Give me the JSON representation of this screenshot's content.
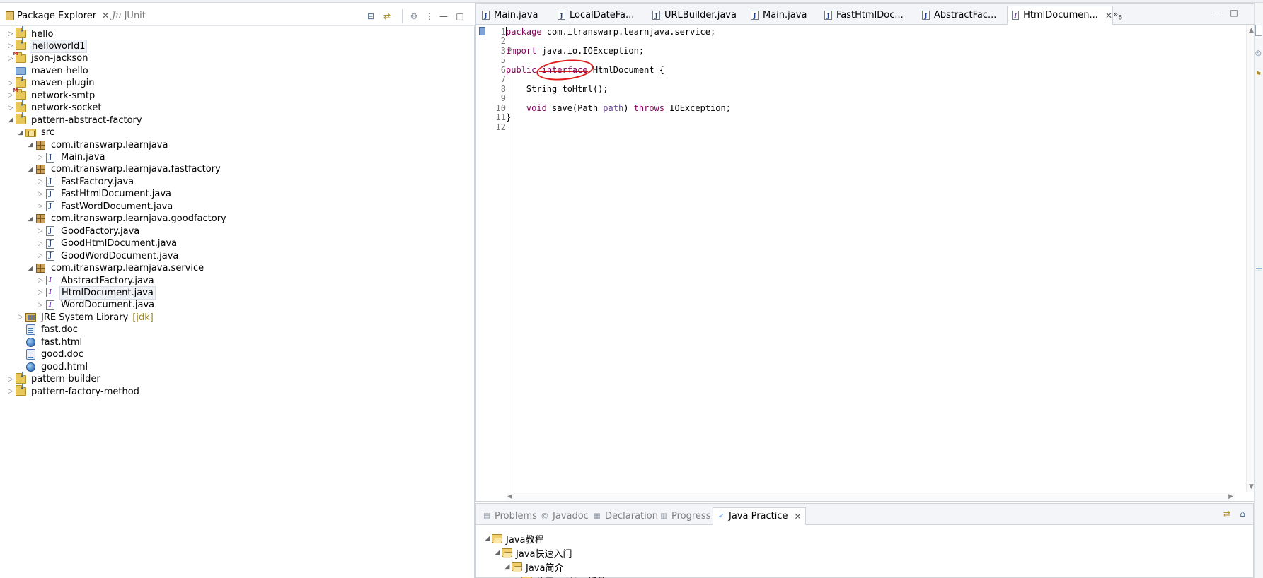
{
  "package_explorer": {
    "tabs": [
      {
        "label": "Package Explorer",
        "active": true
      },
      {
        "label": "JUnit",
        "prefix": "Ju",
        "active": false
      }
    ],
    "tree": [
      {
        "label": "hello",
        "icon": "project-icon",
        "depth": 0,
        "twisty": "collapsed"
      },
      {
        "label": "helloworld1",
        "icon": "project-icon",
        "depth": 0,
        "twisty": "collapsed",
        "selected": true
      },
      {
        "label": "json-jackson",
        "icon": "maven-project-icon",
        "depth": 0,
        "twisty": "collapsed"
      },
      {
        "label": "maven-hello",
        "icon": "folder-icon",
        "depth": 0,
        "twisty": "none"
      },
      {
        "label": "maven-plugin",
        "icon": "project-icon",
        "depth": 0,
        "twisty": "collapsed"
      },
      {
        "label": "network-smtp",
        "icon": "maven-project-icon",
        "depth": 0,
        "twisty": "collapsed"
      },
      {
        "label": "network-socket",
        "icon": "project-icon",
        "depth": 0,
        "twisty": "collapsed"
      },
      {
        "label": "pattern-abstract-factory",
        "icon": "project-icon",
        "depth": 0,
        "twisty": "expanded"
      },
      {
        "label": "src",
        "icon": "source-folder-icon",
        "depth": 1,
        "twisty": "expanded"
      },
      {
        "label": "com.itranswarp.learnjava",
        "icon": "package-icon",
        "depth": 2,
        "twisty": "expanded"
      },
      {
        "label": "Main.java",
        "icon": "java-file-icon",
        "depth": 3,
        "twisty": "collapsed"
      },
      {
        "label": "com.itranswarp.learnjava.fastfactory",
        "icon": "package-icon",
        "depth": 2,
        "twisty": "expanded"
      },
      {
        "label": "FastFactory.java",
        "icon": "java-file-icon",
        "depth": 3,
        "twisty": "collapsed"
      },
      {
        "label": "FastHtmlDocument.java",
        "icon": "java-file-icon",
        "depth": 3,
        "twisty": "collapsed"
      },
      {
        "label": "FastWordDocument.java",
        "icon": "java-file-icon",
        "depth": 3,
        "twisty": "collapsed"
      },
      {
        "label": "com.itranswarp.learnjava.goodfactory",
        "icon": "package-icon",
        "depth": 2,
        "twisty": "expanded"
      },
      {
        "label": "GoodFactory.java",
        "icon": "java-file-icon",
        "depth": 3,
        "twisty": "collapsed"
      },
      {
        "label": "GoodHtmlDocument.java",
        "icon": "java-file-icon",
        "depth": 3,
        "twisty": "collapsed"
      },
      {
        "label": "GoodWordDocument.java",
        "icon": "java-file-icon",
        "depth": 3,
        "twisty": "collapsed"
      },
      {
        "label": "com.itranswarp.learnjava.service",
        "icon": "package-icon",
        "depth": 2,
        "twisty": "expanded"
      },
      {
        "label": "AbstractFactory.java",
        "icon": "java-interface-file-icon",
        "depth": 3,
        "twisty": "collapsed"
      },
      {
        "label": "HtmlDocument.java",
        "icon": "java-interface-file-icon",
        "depth": 3,
        "twisty": "collapsed",
        "selected": true
      },
      {
        "label": "WordDocument.java",
        "icon": "java-interface-file-icon",
        "depth": 3,
        "twisty": "collapsed"
      },
      {
        "label": "JRE System Library",
        "decoration": "[jdk]",
        "icon": "library-icon",
        "depth": 1,
        "twisty": "collapsed"
      },
      {
        "label": "fast.doc",
        "icon": "doc-file-icon",
        "depth": 1,
        "twisty": "none"
      },
      {
        "label": "fast.html",
        "icon": "html-file-icon",
        "depth": 1,
        "twisty": "none"
      },
      {
        "label": "good.doc",
        "icon": "doc-file-icon",
        "depth": 1,
        "twisty": "none"
      },
      {
        "label": "good.html",
        "icon": "html-file-icon",
        "depth": 1,
        "twisty": "none"
      },
      {
        "label": "pattern-builder",
        "icon": "project-icon",
        "depth": 0,
        "twisty": "collapsed"
      },
      {
        "label": "pattern-factory-method",
        "icon": "project-icon",
        "depth": 0,
        "twisty": "collapsed"
      }
    ]
  },
  "editor": {
    "tabs": [
      {
        "label": "Main.java",
        "icon": "java"
      },
      {
        "label": "LocalDateFa...",
        "icon": "java"
      },
      {
        "label": "URLBuilder.java",
        "icon": "java"
      },
      {
        "label": "Main.java",
        "icon": "java"
      },
      {
        "label": "FastHtmlDoc...",
        "icon": "java"
      },
      {
        "label": "AbstractFac...",
        "icon": "java"
      },
      {
        "label": "HtmlDocumen...",
        "icon": "interface",
        "active": true
      }
    ],
    "overflow_count": "6",
    "lines": [
      {
        "n": "1",
        "tokens": [
          {
            "t": "package",
            "c": "kw"
          },
          {
            "t": " com.itranswarp.learnjava.service;"
          }
        ]
      },
      {
        "n": "2",
        "tokens": []
      },
      {
        "n": "3",
        "fold": "⊕",
        "tokens": [
          {
            "t": "import",
            "c": "kw"
          },
          {
            "t": " java.io.IOException;"
          }
        ]
      },
      {
        "n": "5",
        "tokens": []
      },
      {
        "n": "6",
        "tokens": [
          {
            "t": "public",
            "c": "kw"
          },
          {
            "t": " "
          },
          {
            "t": "interface",
            "c": "kw"
          },
          {
            "t": " HtmlDocument {"
          }
        ]
      },
      {
        "n": "7",
        "tokens": []
      },
      {
        "n": "8",
        "tokens": [
          {
            "t": "    String toHtml();"
          }
        ]
      },
      {
        "n": "9",
        "tokens": []
      },
      {
        "n": "10",
        "tokens": [
          {
            "t": "    "
          },
          {
            "t": "void",
            "c": "kw"
          },
          {
            "t": " save(Path "
          },
          {
            "t": "path",
            "c": "param"
          },
          {
            "t": ") "
          },
          {
            "t": "throws",
            "c": "kw"
          },
          {
            "t": " IOException;"
          }
        ]
      },
      {
        "n": "11",
        "tokens": [
          {
            "t": "}"
          }
        ]
      },
      {
        "n": "12",
        "tokens": []
      }
    ]
  },
  "bottom_view": {
    "tabs": [
      {
        "label": "Problems",
        "icon": "problems-icon"
      },
      {
        "label": "Javadoc",
        "prefix": "@",
        "icon": "javadoc-icon"
      },
      {
        "label": "Declaration",
        "icon": "declaration-icon"
      },
      {
        "label": "Progress",
        "icon": "progress-icon"
      },
      {
        "label": "Java Practice",
        "icon": "rocket-icon",
        "active": true
      }
    ],
    "tree": [
      {
        "label": "Java教程",
        "depth": 0
      },
      {
        "label": "Java快速入门",
        "depth": 1
      },
      {
        "label": "Java简介",
        "depth": 2
      },
      {
        "label": "使用IDE练习插件",
        "depth": 3
      }
    ]
  }
}
